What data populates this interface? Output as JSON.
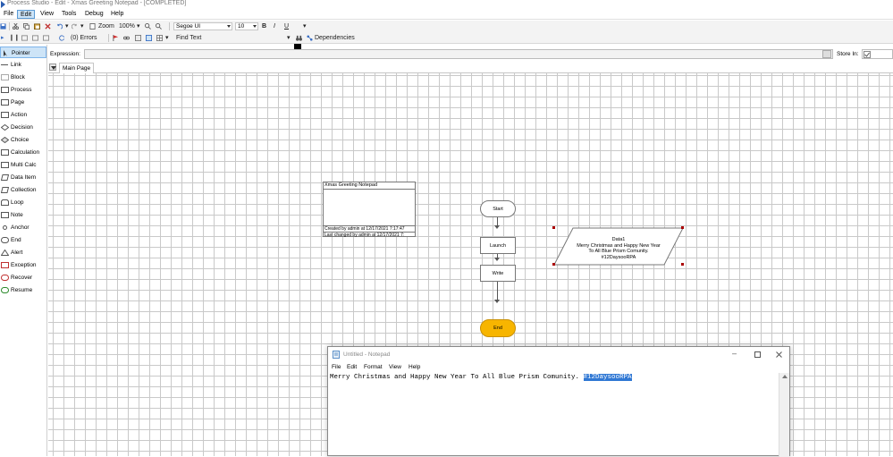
{
  "window": {
    "title": "Process Studio - Edit - Xmas Greeting Notepad - [COMPLETED]"
  },
  "menu": [
    "File",
    "Edit",
    "View",
    "Tools",
    "Debug",
    "Help"
  ],
  "toolbar": {
    "zoom_label": "Zoom",
    "zoom_value": "100%",
    "font_value": "Segoe UI",
    "size_value": "10",
    "bold": "B",
    "italic": "I",
    "underline": "U",
    "errors_label": "(0) Errors",
    "find_text": "Find Text",
    "dependencies_label": "Dependencies"
  },
  "sidebar": {
    "items": [
      "Pointer",
      "Link",
      "Block",
      "Process",
      "Page",
      "Action",
      "Decision",
      "Choice",
      "Calculation",
      "Multi Calc",
      "Data Item",
      "Collection",
      "Loop",
      "Note",
      "Anchor",
      "End",
      "Alert",
      "Exception",
      "Recover",
      "Resume"
    ]
  },
  "expression": {
    "label": "Expression:",
    "store_label": "Store In:"
  },
  "tabs": {
    "main_page": "Main Page"
  },
  "canvas": {
    "info_box": {
      "title": "Xmas Greeting Notepad",
      "created": "Created by admin at 12/17/2021 7:17:47",
      "changed": "Last changed by admin at 12/17/2021 7:"
    },
    "stages": {
      "start": "Start",
      "launch": "Launch",
      "write": "Write",
      "end": "End"
    },
    "data_item": {
      "name": "Data1",
      "value": "Merry Christmas and Happy New Year To All Blue Prism Comunity. #12DaysooRPA"
    },
    "colors": {
      "end_fill": "#f7b500",
      "grid": "#c9c9c9",
      "handle": "#aa0000"
    }
  },
  "notepad": {
    "title": "Untitled - Notepad",
    "menu": [
      "File",
      "Edit",
      "Format",
      "View",
      "Help"
    ],
    "text": "Merry Christmas and Happy New Year To All Blue Prism Comunity. ",
    "selected_text": "#12DaysooRPA"
  }
}
